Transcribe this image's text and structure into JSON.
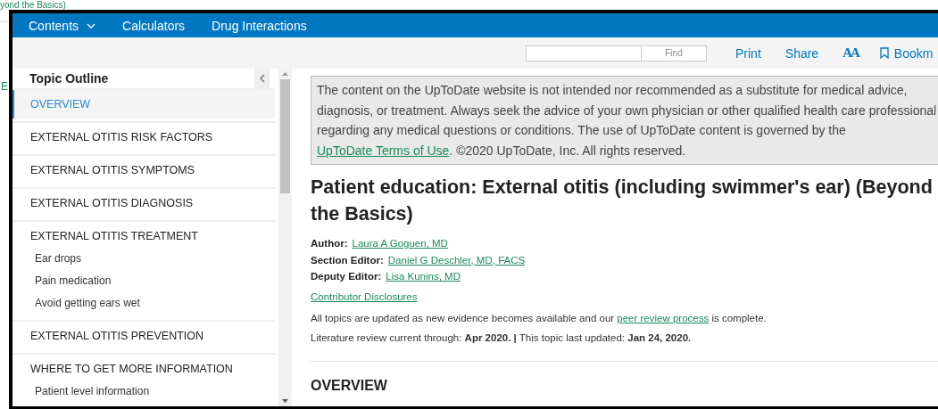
{
  "backdrop": {
    "title_fragment": "yond the Basics)",
    "link_fragment": "E"
  },
  "nav": {
    "items": [
      {
        "label": "Contents",
        "dropdown": true
      },
      {
        "label": "Calculators",
        "dropdown": false
      },
      {
        "label": "Drug Interactions",
        "dropdown": false
      }
    ]
  },
  "toolbar": {
    "find_button": "Find",
    "actions": [
      "Print",
      "Share"
    ],
    "font_size": "AA",
    "bookmark": "Bookm"
  },
  "outline": {
    "title": "Topic Outline",
    "items": [
      {
        "label": "OVERVIEW",
        "selected": true
      },
      {
        "label": "EXTERNAL OTITIS RISK FACTORS",
        "selected": false
      },
      {
        "label": "EXTERNAL OTITIS SYMPTOMS",
        "selected": false
      },
      {
        "label": "EXTERNAL OTITIS DIAGNOSIS",
        "selected": false
      },
      {
        "label": "EXTERNAL OTITIS TREATMENT",
        "selected": false,
        "children": [
          {
            "label": "Ear drops"
          },
          {
            "label": "Pain medication"
          },
          {
            "label": "Avoid getting ears wet"
          }
        ]
      },
      {
        "label": "EXTERNAL OTITIS PREVENTION",
        "selected": false
      },
      {
        "label": "WHERE TO GET MORE INFORMATION",
        "selected": false,
        "children": [
          {
            "label": "Patient level information"
          }
        ]
      }
    ]
  },
  "article": {
    "disclaimer": {
      "text": "The content on the UpToDate website is not intended nor recommended as a substitute for medical advice, diagnosis, or treatment. Always seek the advice of your own physician or other qualified health care professional regarding any medical questions or conditions. The use of UpToDate content is governed by the ",
      "link": "UpToDate Terms of Use",
      "after": ". ©2020 UpToDate, Inc. All rights reserved."
    },
    "title": "Patient education: External otitis (including swimmer's ear) (Beyond the Basics)",
    "credits": [
      {
        "role": "Author:",
        "name": "Laura A Goguen, MD"
      },
      {
        "role": "Section Editor:",
        "name": "Daniel G Deschler, MD, FACS"
      },
      {
        "role": "Deputy Editor:",
        "name": "Lisa Kunins, MD"
      }
    ],
    "disclosures": "Contributor Disclosures",
    "update_note": {
      "text": "All topics are updated as new evidence becomes available and our ",
      "link": "peer review process",
      "after": " is complete."
    },
    "review": "Literature review current through: **Apr 2020. |** This topic last updated: **Jan 24, 2020.**",
    "section_heading": "OVERVIEW"
  }
}
